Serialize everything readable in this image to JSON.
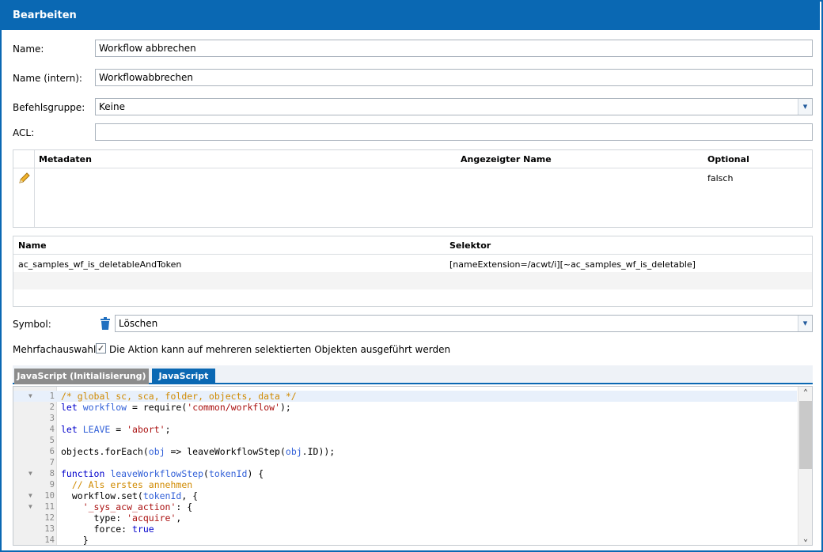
{
  "dialog": {
    "title": "Bearbeiten"
  },
  "form": {
    "name_label": "Name:",
    "name_value": "Workflow abbrechen",
    "intern_label": "Name (intern):",
    "intern_value": "Workflowabbrechen",
    "group_label": "Befehlsgruppe:",
    "group_value": "Keine",
    "acl_label": "ACL:",
    "acl_value": "",
    "symbol_label": "Symbol:",
    "symbol_value": "Löschen",
    "multi_label": "Mehrfachauswahl:",
    "multi_text": "Die Aktion kann auf mehreren selektierten Objekten ausgeführt werden"
  },
  "metadata_table": {
    "headers": [
      "Metadaten",
      "Angezeigter Name",
      "Optional"
    ],
    "rows": [
      {
        "metadaten": "",
        "name": "",
        "optional": "falsch"
      }
    ]
  },
  "selector_table": {
    "headers": [
      "Name",
      "Selektor"
    ],
    "rows": [
      {
        "name": "ac_samples_wf_is_deletableAndToken",
        "selektor": "[nameExtension=/acwt/i][~ac_samples_wf_is_deletable]"
      }
    ]
  },
  "tabs": [
    "JavaScript (Initialisierung)",
    "JavaScript"
  ],
  "editor": {
    "line_numbers": [
      "1",
      "2",
      "3",
      "4",
      "5",
      "6",
      "7",
      "8",
      "9",
      "10",
      "11",
      "12",
      "13",
      "14"
    ]
  },
  "colors": {
    "accent": "#0a68b3",
    "tab_inactive": "#8c8c8c"
  }
}
